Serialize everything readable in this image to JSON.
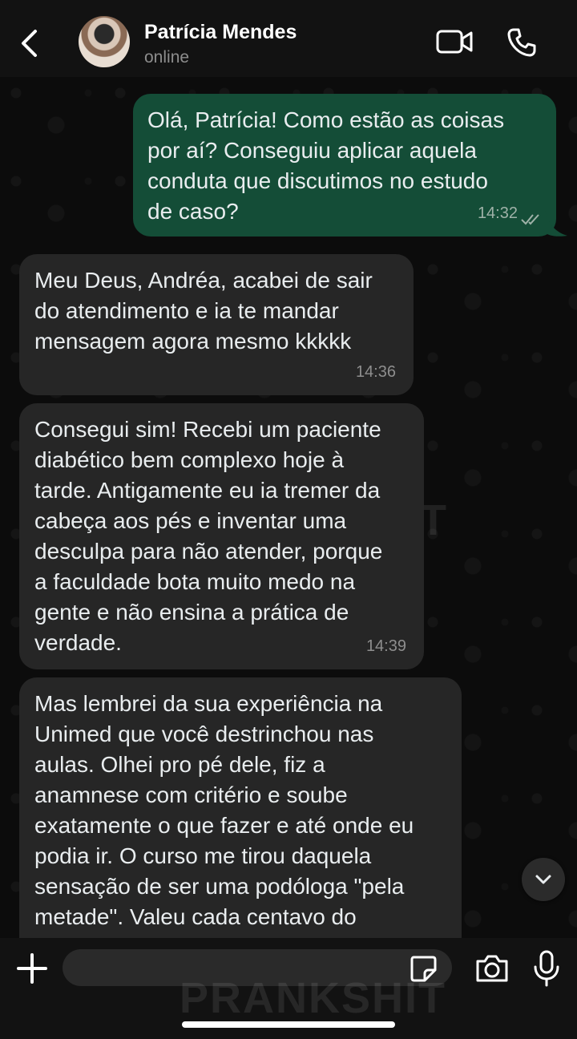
{
  "header": {
    "contact_name": "Patrícia Mendes",
    "status": "online",
    "watermark": "PRANKSHIT",
    "icons": [
      "back-chevron-icon",
      "video-icon",
      "phone-icon"
    ]
  },
  "messages": [
    {
      "direction": "outgoing",
      "text": "Olá, Patrícia! Como estão as coisas\npor aí? Conseguiu aplicar aquela\nconduta que discutimos no estudo\nde caso?",
      "time": "14:32",
      "status": "read"
    },
    {
      "direction": "incoming",
      "text": "Meu Deus, Andréa, acabei de sair\ndo atendimento e ia te mandar\nmensagem agora mesmo kkkkk",
      "time": "14:36"
    },
    {
      "direction": "incoming",
      "text": "Consegui sim! Recebi um paciente\ndiabético bem complexo hoje à\ntarde. Antigamente eu ia tremer da\ncabeça aos pés e inventar uma\ndesculpa para não atender, porque\na faculdade bota muito medo na\ngente e não ensina a prática de\nverdade.",
      "time": "14:39"
    },
    {
      "direction": "incoming",
      "text": "Mas lembrei da sua experiência na\nUnimed que você destrinchou nas\naulas. Olhei pro pé dele, fiz a\nanamnese com critério e soube\nexatamente o que fazer e até onde eu\npodia ir. O curso me tirou daquela\nsensação de ser uma podóloga \"pela\nmetade\". Valeu cada centavo do"
    }
  ],
  "composer": {
    "placeholder": "",
    "icons": [
      "plus-icon",
      "sticker-icon",
      "camera-icon",
      "mic-icon"
    ]
  },
  "colors": {
    "outgoing_bubble": "#144d37",
    "incoming_bubble": "#262626",
    "background": "#0c0c0c"
  }
}
